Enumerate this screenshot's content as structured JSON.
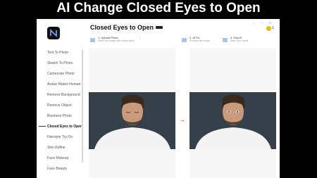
{
  "banner": {
    "title": "AI Change Closed Eyes to Open"
  },
  "app": {
    "title": "Closed Eyes to Open",
    "credits": "1"
  },
  "sidebar": {
    "items": [
      {
        "label": "Text To Photo"
      },
      {
        "label": "Sketch To Photo"
      },
      {
        "label": "Cartoonize Photo"
      },
      {
        "label": "Avatar Maker-Human"
      },
      {
        "label": "Remove Background"
      },
      {
        "label": "Remove Object"
      },
      {
        "label": "Business Photo"
      },
      {
        "label": "Closed Eyes to Open",
        "active": true
      },
      {
        "label": "Hairstyle Try-On"
      },
      {
        "label": "Skin Refine"
      },
      {
        "label": "Face Makeup"
      },
      {
        "label": "Face Beauty"
      }
    ]
  },
  "steps": [
    {
      "title": "1. Upload Photo",
      "subtitle": "Select an image with closed eyes"
    },
    {
      "title": "2. AI Fix",
      "subtitle": "Process the image"
    },
    {
      "title": "3. Export",
      "subtitle": "Save your result"
    }
  ],
  "colors": {
    "accent": "#f2b90d",
    "photo_bg": "#36404a",
    "step_icon": "#aac4e8"
  }
}
